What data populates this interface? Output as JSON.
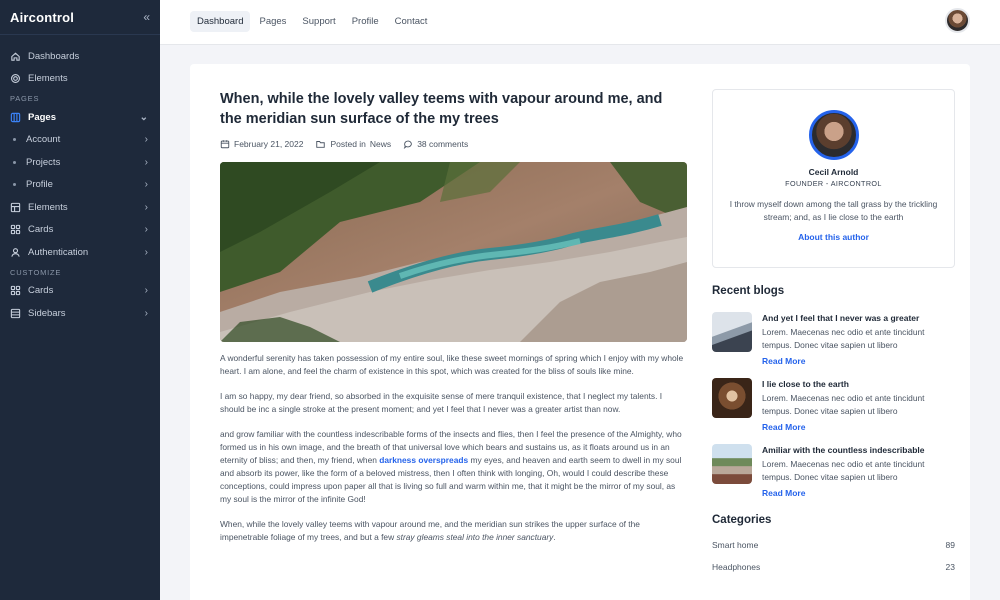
{
  "brand": {
    "logo": "Aircontrol",
    "collapse_icon": "«"
  },
  "sidebar": {
    "items_top": [
      {
        "label": "Dashboards",
        "icon": "home-icon"
      },
      {
        "label": "Elements",
        "icon": "gear-icon"
      }
    ],
    "section_pages": "PAGES",
    "pages": {
      "label": "Pages",
      "icon": "layout-icon"
    },
    "sub_items": [
      {
        "label": "Account"
      },
      {
        "label": "Projects"
      },
      {
        "label": "Profile"
      }
    ],
    "items_mid": [
      {
        "label": "Elements",
        "icon": "elements-icon"
      },
      {
        "label": "Cards",
        "icon": "cards-icon"
      },
      {
        "label": "Authentication",
        "icon": "user-icon"
      }
    ],
    "section_customize": "CUSTOMIZE",
    "items_bottom": [
      {
        "label": "Cards",
        "icon": "cards-icon"
      },
      {
        "label": "Sidebars",
        "icon": "sidebar-icon"
      }
    ]
  },
  "topbar": {
    "tabs": [
      "Dashboard",
      "Pages",
      "Support",
      "Profile",
      "Contact"
    ],
    "active_tab": "Dashboard"
  },
  "article": {
    "title": "When, while the lovely valley teems with vapour around me, and the meridian sun surface of the my trees",
    "date": "February 21, 2022",
    "posted_prefix": "Posted in",
    "category": "News",
    "comments": "38 comments",
    "p1": "A wonderful serenity has taken possession of my entire soul, like these sweet mornings of spring which I enjoy with my whole heart. I am alone, and feel the charm of existence in this spot, which was created for the bliss of souls like mine.",
    "p2": "I am so happy, my dear friend, so absorbed in the exquisite sense of mere tranquil existence, that I neglect my talents. I should be inc a single stroke at the present moment; and yet I feel that I never was a greater artist than now.",
    "p3_before": "and grow familiar with the countless indescribable forms of the insects and flies, then I feel the presence of the Almighty, who formed us in his own image, and the breath of that universal love which bears and sustains us, as it floats around us in an eternity of bliss; and then, my friend, when ",
    "p3_link": "darkness overspreads",
    "p3_after": " my eyes, and heaven and earth seem to dwell in my soul and absorb its power, like the form of a beloved mistress, then I often think with longing, Oh, would I could describe these conceptions, could impress upon paper all that is living so full and warm within me, that it might be the mirror of my soul, as my soul is the mirror of the infinite God!",
    "p4_before": "When, while the lovely valley teems with vapour around me, and the meridian sun strikes the upper surface of the impenetrable foliage of my trees, and but a few ",
    "p4_italic": "stray gleams steal into the inner sanctuary",
    "p4_after": "."
  },
  "author": {
    "name": "Cecil Arnold",
    "role": "FOUNDER - AIRCONTROL",
    "bio": "I throw myself down among the tall grass by the trickling stream; and, as I lie close to the earth",
    "link": "About this author"
  },
  "recent_blogs": {
    "title": "Recent blogs",
    "items": [
      {
        "title": "And yet I feel that I never was a greater",
        "desc": "Lorem. Maecenas nec odio et ante tincidunt tempus. Donec vitae sapien ut libero",
        "more": "Read More"
      },
      {
        "title": "I lie close to the earth",
        "desc": "Lorem. Maecenas nec odio et ante tincidunt tempus. Donec vitae sapien ut libero",
        "more": "Read More"
      },
      {
        "title": "Amiliar with the countless indescribable",
        "desc": "Lorem. Maecenas nec odio et ante tincidunt tempus. Donec vitae sapien ut libero",
        "more": "Read More"
      }
    ]
  },
  "categories": {
    "title": "Categories",
    "items": [
      {
        "name": "Smart home",
        "count": "89"
      },
      {
        "name": "Headphones",
        "count": "23"
      }
    ]
  }
}
